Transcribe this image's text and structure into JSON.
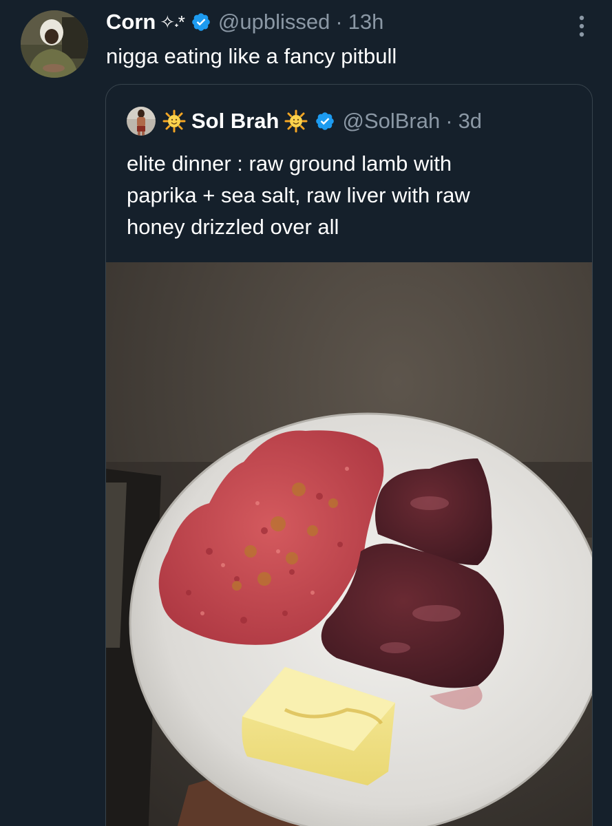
{
  "tweet": {
    "author_name": "Corn",
    "author_name_emoji": "✧˖*",
    "handle": "@upblissed",
    "separator": "·",
    "time": "13h",
    "text": "nigga eating like a fancy pitbull"
  },
  "quote": {
    "author_name": "Sol Brah",
    "handle": "@SolBrah",
    "separator": "·",
    "time": "3d",
    "text_lines": [
      "elite dinner : raw ground lamb with",
      "paprika + sea salt, raw liver with raw",
      "honey drizzled over all"
    ]
  },
  "colors": {
    "background": "#15202b",
    "secondary_text": "#8b98a5",
    "verified_blue": "#1d9bf0",
    "border": "#38444d"
  },
  "icons": {
    "verified": "verified-badge-icon",
    "more": "more-options-icon",
    "sun": "sun-emoji-icon"
  }
}
